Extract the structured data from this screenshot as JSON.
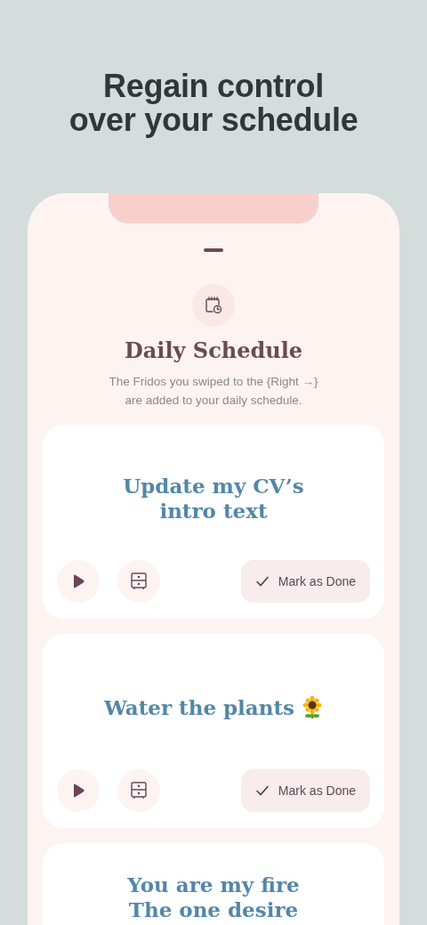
{
  "headline": "Regain control\nover your schedule",
  "sheet": {
    "title": "Daily Schedule",
    "subtitle": "The Fridos you swiped to the {Right →}\nare added to your daily schedule."
  },
  "tasks": [
    {
      "kind": "text",
      "title": "Update my CV’s\nintro text",
      "mark_label": "Mark as Done"
    },
    {
      "kind": "sunflower",
      "title": "Water the plants",
      "mark_label": "Mark as Done"
    },
    {
      "kind": "text",
      "title": "You are my fire\nThe one desire"
    }
  ]
}
